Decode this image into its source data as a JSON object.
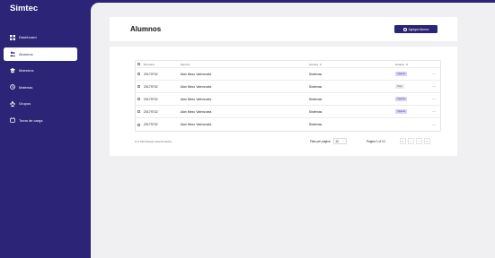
{
  "app": {
    "title": "Simtec"
  },
  "sidebar": {
    "items": [
      {
        "label": "Dashboard",
        "icon": "dashboard-icon",
        "active": false
      },
      {
        "label": "Alumnos",
        "icon": "users-icon",
        "active": true
      },
      {
        "label": "Maestros",
        "icon": "teacher-icon",
        "active": false
      },
      {
        "label": "Materias",
        "icon": "book-icon",
        "active": false
      },
      {
        "label": "Grupos",
        "icon": "group-icon",
        "active": false
      },
      {
        "label": "Toma de carga",
        "icon": "load-icon",
        "active": false
      }
    ]
  },
  "header": {
    "title": "Alumnos",
    "add_button": "Agregar Alumno"
  },
  "table": {
    "columns": {
      "id": "NControl",
      "name": "Nombre",
      "carrera": "Carrera",
      "estatus": "Estatus"
    },
    "rows": [
      {
        "id": "20179732",
        "name": "Alan Mezo Valenzuela",
        "carrera": "Sistemas",
        "estatus": "Vigente",
        "status_type": "reg"
      },
      {
        "id": "20179732",
        "name": "Alan Mezo Valenzuela",
        "carrera": "Sistemas",
        "estatus": "Baja",
        "status_type": "baja"
      },
      {
        "id": "20179732",
        "name": "Alan Mezo Valenzuela",
        "carrera": "Sistemas",
        "estatus": "Vigente",
        "status_type": "reg"
      },
      {
        "id": "20179732",
        "name": "Alan Mezo Valenzuela",
        "carrera": "Sistemas",
        "estatus": "Vigente",
        "status_type": "reg"
      },
      {
        "id": "20179732",
        "name": "Alan Mezo Valenzuela",
        "carrera": "Sistemas",
        "estatus": "",
        "status_type": "none"
      }
    ],
    "row_action": "⋯"
  },
  "footer": {
    "selected": "0 of 100 Row(s) seleccionados.",
    "rows_per_page_label": "Filas per pagina",
    "rows_per_page_value": "10",
    "page_info": "Pagina 1 of 10",
    "pager": [
      "«",
      "‹",
      "›",
      "»"
    ]
  },
  "colors": {
    "sidebar": "#2c2577",
    "accent": "#2c2577",
    "content_bg": "#f0f0f3",
    "badge_reg": "#d7d4f1"
  }
}
